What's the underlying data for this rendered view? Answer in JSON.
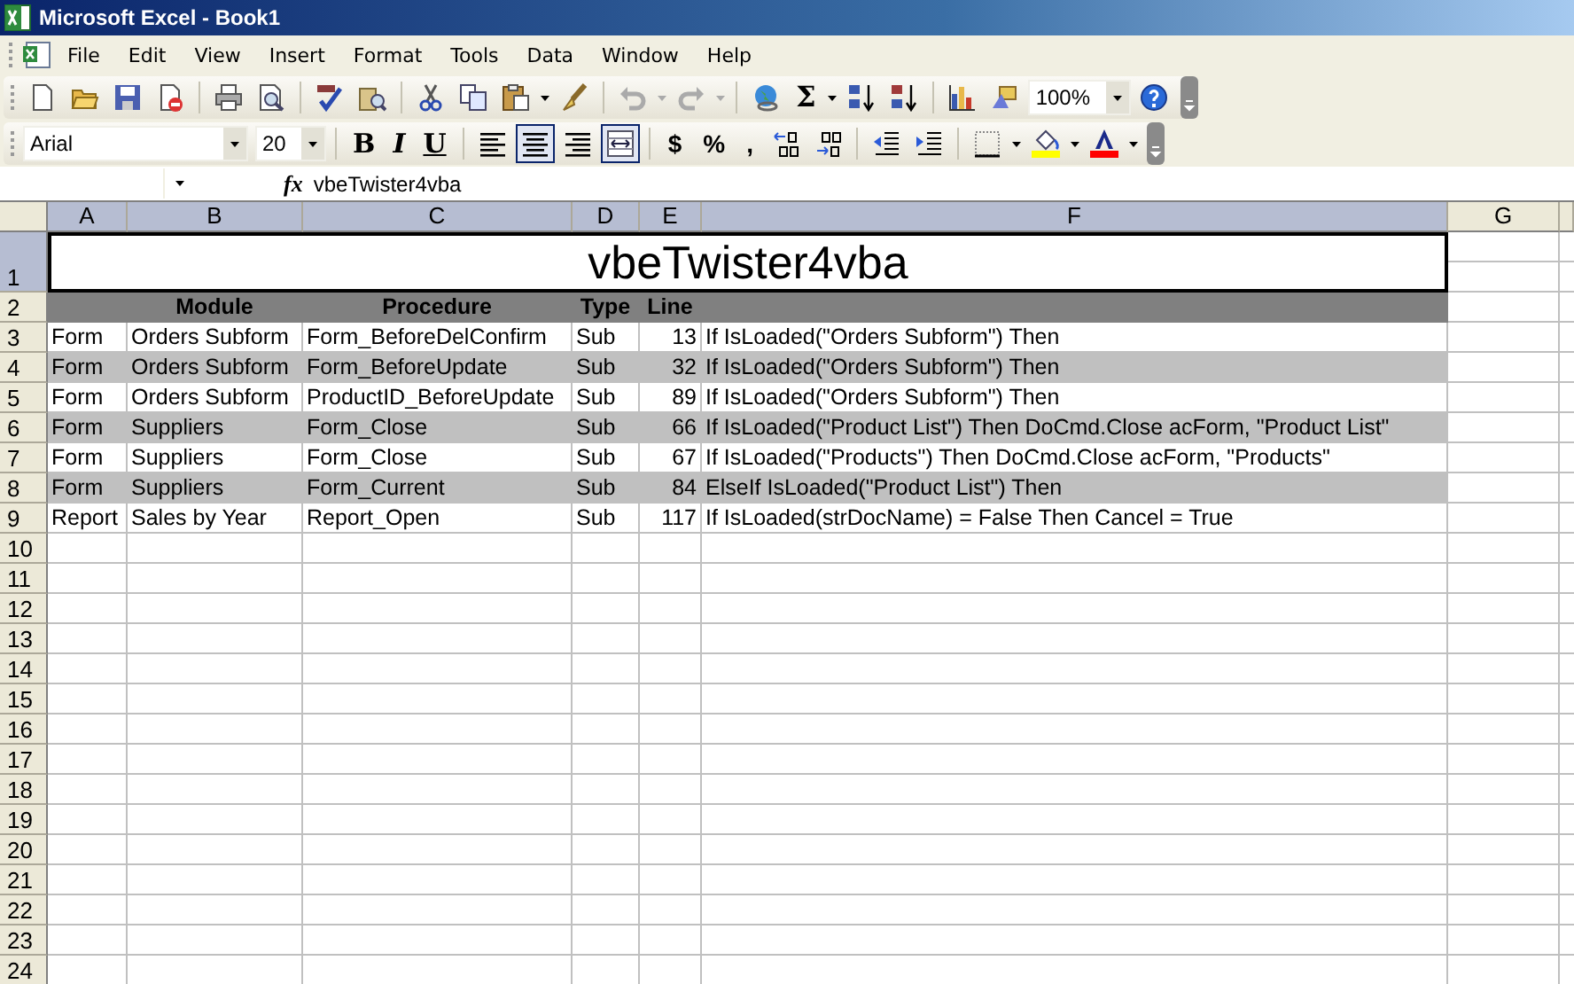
{
  "window": {
    "title": "Microsoft Excel - Book1"
  },
  "menu": [
    {
      "label": "File"
    },
    {
      "label": "Edit"
    },
    {
      "label": "View"
    },
    {
      "label": "Insert"
    },
    {
      "label": "Format"
    },
    {
      "label": "Tools"
    },
    {
      "label": "Data"
    },
    {
      "label": "Window"
    },
    {
      "label": "Help"
    }
  ],
  "toolbar_standard": {
    "sum_label": "Σ",
    "zoom": "100%"
  },
  "toolbar_formatting": {
    "font": "Arial",
    "size": "20",
    "style_buttons": [
      {
        "label": "B",
        "kind": "bold"
      },
      {
        "label": "I",
        "kind": "italic"
      },
      {
        "label": "U",
        "kind": "underline"
      }
    ],
    "align_buttons": [
      {
        "kind": "left",
        "selected": false
      },
      {
        "kind": "center",
        "selected": true
      },
      {
        "kind": "right",
        "selected": false
      },
      {
        "kind": "merge",
        "selected": true
      }
    ],
    "number_buttons": [
      {
        "label": "$"
      },
      {
        "label": "%"
      },
      {
        "label": ","
      }
    ]
  },
  "formula_bar": {
    "fx_label": "fx",
    "content": "vbeTwister4vba"
  },
  "sheet": {
    "columns": [
      {
        "label": "A",
        "selected": true
      },
      {
        "label": "B",
        "selected": true
      },
      {
        "label": "C",
        "selected": true
      },
      {
        "label": "D",
        "selected": true
      },
      {
        "label": "E",
        "selected": true
      },
      {
        "label": "F",
        "selected": true
      },
      {
        "label": "G",
        "selected": false
      }
    ],
    "title_row": {
      "number": "1",
      "selected": true,
      "text": "vbeTwister4vba"
    },
    "header_row": {
      "number": "2",
      "selected": false,
      "module": "Module",
      "procedure": "Procedure",
      "type": "Type",
      "line": "Line"
    },
    "rows": [
      {
        "number": "3",
        "selected": false,
        "shaded": false,
        "cells": [
          "Form",
          "Orders Subform",
          "Form_BeforeDelConfirm",
          "Sub",
          "13",
          "If IsLoaded(\"Orders Subform\") Then"
        ]
      },
      {
        "number": "4",
        "selected": false,
        "shaded": true,
        "cells": [
          "Form",
          "Orders Subform",
          "Form_BeforeUpdate",
          "Sub",
          "32",
          "If IsLoaded(\"Orders Subform\") Then"
        ]
      },
      {
        "number": "5",
        "selected": false,
        "shaded": false,
        "cells": [
          "Form",
          "Orders Subform",
          "ProductID_BeforeUpdate",
          "Sub",
          "89",
          "If IsLoaded(\"Orders Subform\") Then"
        ]
      },
      {
        "number": "6",
        "selected": false,
        "shaded": true,
        "cells": [
          "Form",
          "Suppliers",
          "Form_Close",
          "Sub",
          "66",
          "If IsLoaded(\"Product List\") Then DoCmd.Close acForm, \"Product List\""
        ]
      },
      {
        "number": "7",
        "selected": false,
        "shaded": false,
        "cells": [
          "Form",
          "Suppliers",
          "Form_Close",
          "Sub",
          "67",
          "If IsLoaded(\"Products\") Then DoCmd.Close acForm, \"Products\""
        ]
      },
      {
        "number": "8",
        "selected": false,
        "shaded": true,
        "cells": [
          "Form",
          "Suppliers",
          "Form_Current",
          "Sub",
          "84",
          "ElseIf IsLoaded(\"Product List\") Then"
        ]
      },
      {
        "number": "9",
        "selected": false,
        "shaded": false,
        "cells": [
          "Report",
          "Sales by Year",
          "Report_Open",
          "Sub",
          "117",
          "If IsLoaded(strDocName) = False Then Cancel = True"
        ]
      }
    ],
    "empty_rows": [
      {
        "number": "10",
        "selected": false
      },
      {
        "number": "11",
        "selected": false
      },
      {
        "number": "12",
        "selected": false
      },
      {
        "number": "13",
        "selected": false
      },
      {
        "number": "14",
        "selected": false
      },
      {
        "number": "15",
        "selected": false
      },
      {
        "number": "16",
        "selected": false
      },
      {
        "number": "17",
        "selected": false
      },
      {
        "number": "18",
        "selected": false
      },
      {
        "number": "19",
        "selected": false
      },
      {
        "number": "20",
        "selected": false
      },
      {
        "number": "21",
        "selected": false
      },
      {
        "number": "22",
        "selected": false
      },
      {
        "number": "23",
        "selected": false
      },
      {
        "number": "24",
        "selected": false
      }
    ]
  }
}
